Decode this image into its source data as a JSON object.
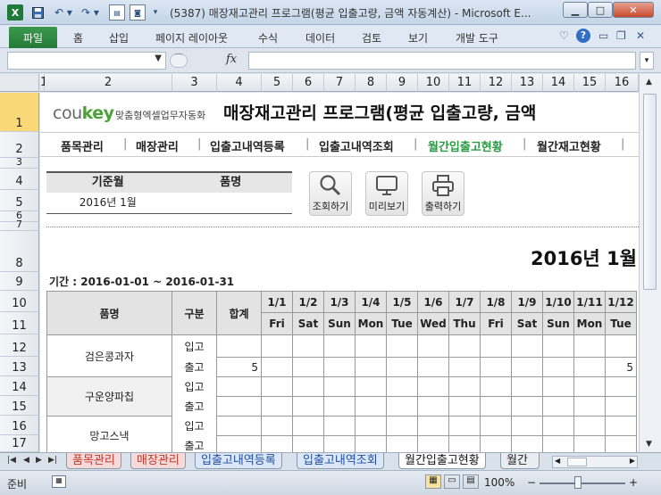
{
  "window": {
    "title": "(5387) 매장재고관리 프로그램(평균 입출고량, 금액 자동계산) - Microsoft E...",
    "app_icon": "X",
    "minimize": "▁",
    "maximize": "□",
    "close": "✕"
  },
  "ribbon": {
    "file": "파일",
    "tabs": [
      "홈",
      "삽입",
      "페이지 레이아웃",
      "수식",
      "데이터",
      "검토",
      "보기",
      "개발 도구"
    ]
  },
  "formula_bar": {
    "fx": "fx",
    "name_value": "",
    "formula_value": ""
  },
  "columns": [
    "1",
    "2",
    "3",
    "4",
    "5",
    "6",
    "7",
    "8",
    "9",
    "10",
    "11",
    "12",
    "13",
    "14",
    "15",
    "16"
  ],
  "rows": [
    "1",
    "2",
    "3",
    "4",
    "5",
    "6",
    "7",
    "8",
    "9",
    "10",
    "11",
    "12",
    "13",
    "14",
    "15",
    "16",
    "17"
  ],
  "header": {
    "logo_main": "cou",
    "logo_accent": "key",
    "logo_sub": "맞춤형엑셀업무자동화",
    "program_title": "매장재고관리 프로그램(평균 입출고량, 금액"
  },
  "nav": {
    "items": [
      "품목관리",
      "매장관리",
      "입출고내역등록",
      "입출고내역조회",
      "월간입출고현황",
      "월간재고현황"
    ],
    "separator": "|",
    "active": "월간입출고현황"
  },
  "filter": {
    "month_label": "기준월",
    "item_label": "품명",
    "month_value": "2016년 1월",
    "item_value": ""
  },
  "buttons": {
    "search": "조회하기",
    "preview": "미리보기",
    "print": "출력하기"
  },
  "report": {
    "month_title": "2016년 1월",
    "period": "기간 : 2016-01-01 ~ 2016-01-31",
    "col_item": "품명",
    "col_type": "구분",
    "col_total": "합계",
    "dates": [
      "1/1",
      "1/2",
      "1/3",
      "1/4",
      "1/5",
      "1/6",
      "1/7",
      "1/8",
      "1/9",
      "1/10",
      "1/11",
      "1/12"
    ],
    "weekdays": [
      "Fri",
      "Sat",
      "Sun",
      "Mon",
      "Tue",
      "Wed",
      "Thu",
      "Fri",
      "Sat",
      "Sun",
      "Mon",
      "Tue"
    ],
    "in_label": "입고",
    "out_label": "출고",
    "products": [
      {
        "name": "검은콩과자",
        "in_total": "",
        "out_total": "5",
        "out_1_12": "5"
      },
      {
        "name": "구운양파칩",
        "in_total": "",
        "out_total": ""
      },
      {
        "name": "망고스낵",
        "in_total": "",
        "out_total": ""
      }
    ]
  },
  "sheet_tabs": [
    "품목관리",
    "매장관리",
    "입출고내역등록",
    "입출고내역조회",
    "월간입출고현황",
    "월간"
  ],
  "status": {
    "ready": "준비",
    "zoom": "100%",
    "zoom_minus": "−",
    "zoom_plus": "+"
  }
}
